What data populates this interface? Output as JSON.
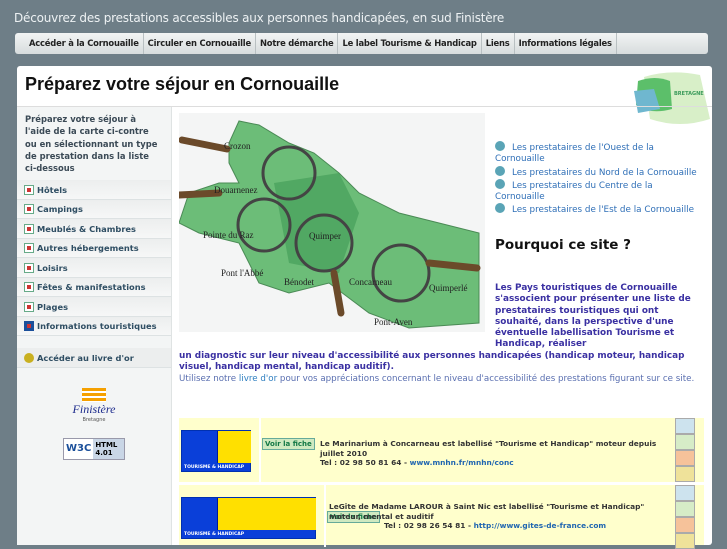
{
  "tagline": "Découvrez des prestations accessibles aux personnes handicapées, en sud Finistère",
  "nav": [
    "Accéder à la Cornouaille",
    "Circuler en Cornouaille",
    "Notre démarche",
    "Le label Tourisme & Handicap",
    "Liens",
    "Informations légales"
  ],
  "page_title": "Préparez votre séjour en Cornouaille",
  "region_logo": "BRETAGNE",
  "sidebar": {
    "intro": "Préparez votre séjour à l'aide de la carte ci-contre ou en sélectionnant un type de prestation dans la liste ci-dessous",
    "items": [
      {
        "label": "Hôtels",
        "icon": "hotel-icon"
      },
      {
        "label": "Campings",
        "icon": "camping-icon"
      },
      {
        "label": "Meublés & Chambres",
        "icon": "furnished-icon"
      },
      {
        "label": "Autres hébergements",
        "icon": "lodging-icon"
      },
      {
        "label": "Loisirs",
        "icon": "leisure-icon"
      },
      {
        "label": "Fêtes & manifestations",
        "icon": "festival-icon"
      },
      {
        "label": "Plages",
        "icon": "beach-icon"
      },
      {
        "label": "Informations touristiques",
        "icon": "info-icon"
      }
    ],
    "guestbook": "Accéder au livre d'or",
    "finistere_logo": "Finistère",
    "finistere_sub": "Bretagne",
    "w3c": "W3C",
    "w3c_html": "HTML 4.01"
  },
  "map": {
    "places": [
      "Crozon",
      "Douarnenez",
      "Pointe du Raz",
      "Pont l'Abbé",
      "Bénodet",
      "Quimper",
      "Concarneau",
      "Quimperlé",
      "Pont-Aven"
    ]
  },
  "links": [
    "Les prestataires de l'Ouest de la Cornouaille",
    "Les prestataires du Nord de la Cornouaille",
    "Les prestataires du Centre de la Cornouaille",
    "Les prestataires de l'Est de la Cornouaille"
  ],
  "why_title": "Pourquoi ce site ?",
  "why_text_1": "Les Pays touristiques de Cornouaille s'associent pour présenter une liste de prestataires touristiques qui ont souhaité, dans la perspective d'une éventuelle labellisation Tourisme et Handicap, réaliser",
  "why_text_2": "un diagnostic sur leur niveau d'accessibilité aux personnes handicapées (handicap moteur, handicap visuel, handicap mental, handicap auditif).",
  "guestbook_pre": "Utilisez notre ",
  "guestbook_link": "livre d'or",
  "guestbook_post": " pour vos appréciations concernant le niveau d'accessibilité des prestations figurant sur ce site.",
  "label_logo": "TOURISME & HANDICAP",
  "listings": [
    {
      "button": "Voir la fiche",
      "text": "Le Marinarium à Concarneau est labellisé \"Tourisme et Handicap\" moteur depuis juillet 2010",
      "tel": "Tel : 02 98 50 81 64 - ",
      "url": "www.mnhn.fr/mnhn/conc"
    },
    {
      "button": "Voir la fiche",
      "text": "LeGîte de Madame LAROUR à Saint Nic est labellisé \"Tourisme et Handicap\" moteur, mental et auditif",
      "tel": "Tel : 02 98 26 54 81 - ",
      "url": "http://www.gites-de-france.com"
    }
  ],
  "colors": {
    "background": "#6e7e87",
    "accent": "#3a30a2",
    "link": "#2f6fb7",
    "listing_bg": "#ffffcc"
  }
}
